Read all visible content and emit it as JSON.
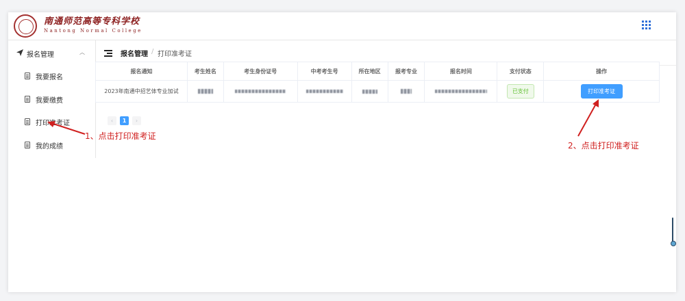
{
  "header": {
    "logo_cn": "南通师范高等专科学校",
    "logo_en": "Nantong Normal College"
  },
  "sidebar": {
    "group_label": "报名管理",
    "items": [
      {
        "label": "我要报名"
      },
      {
        "label": "我要缴费"
      },
      {
        "label": "打印准考证"
      },
      {
        "label": "我的成绩"
      }
    ]
  },
  "breadcrumb": {
    "level1": "报名管理",
    "separator": "/",
    "level2": "打印准考证"
  },
  "table": {
    "columns": [
      "报名通知",
      "考生姓名",
      "考生身份证号",
      "中考考生号",
      "所在地区",
      "报考专业",
      "报名时间",
      "支付状态",
      "操作"
    ],
    "rows": [
      {
        "notice": "2023年南通中招艺体专业加试",
        "status": "已支付",
        "action": "打印准考证"
      }
    ]
  },
  "pagination": {
    "prev": "‹",
    "current": "1",
    "next": "›"
  },
  "annotations": {
    "step1": "1、点击打印准考证",
    "step2": "2、点击打印准考证",
    "color": "#d0201f"
  },
  "colors": {
    "primary": "#409eff",
    "success": "#67c23a",
    "brand": "#8e2222"
  }
}
